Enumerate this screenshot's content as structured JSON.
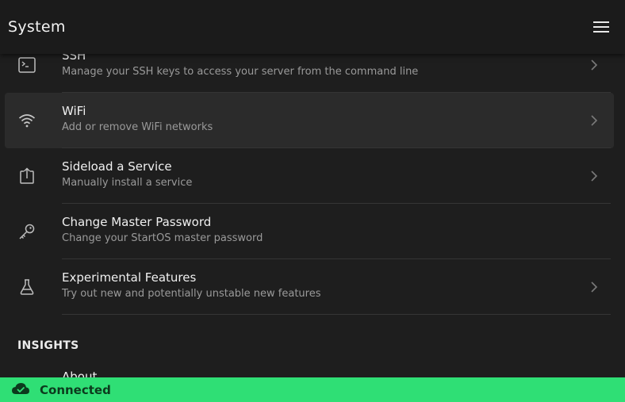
{
  "header": {
    "title": "System",
    "menu_icon": "hamburger-menu-icon"
  },
  "items": [
    {
      "label": "SSH",
      "description": "Manage your SSH keys to access your server from the command line",
      "icon": "terminal-icon"
    },
    {
      "label": "WiFi",
      "description": "Add or remove WiFi networks",
      "icon": "wifi-icon"
    },
    {
      "label": "Sideload a Service",
      "description": "Manually install a service",
      "icon": "upload-icon"
    },
    {
      "label": "Change Master Password",
      "description": "Change your StartOS master password",
      "icon": "key-icon"
    },
    {
      "label": "Experimental Features",
      "description": "Try out new and potentially unstable new features",
      "icon": "flask-icon"
    }
  ],
  "insights": {
    "title": "INSIGHTS",
    "items": [
      {
        "label": "About"
      }
    ]
  },
  "status": {
    "text": "Connected",
    "icon": "cloud-check-icon",
    "color": "#2fdf75"
  }
}
